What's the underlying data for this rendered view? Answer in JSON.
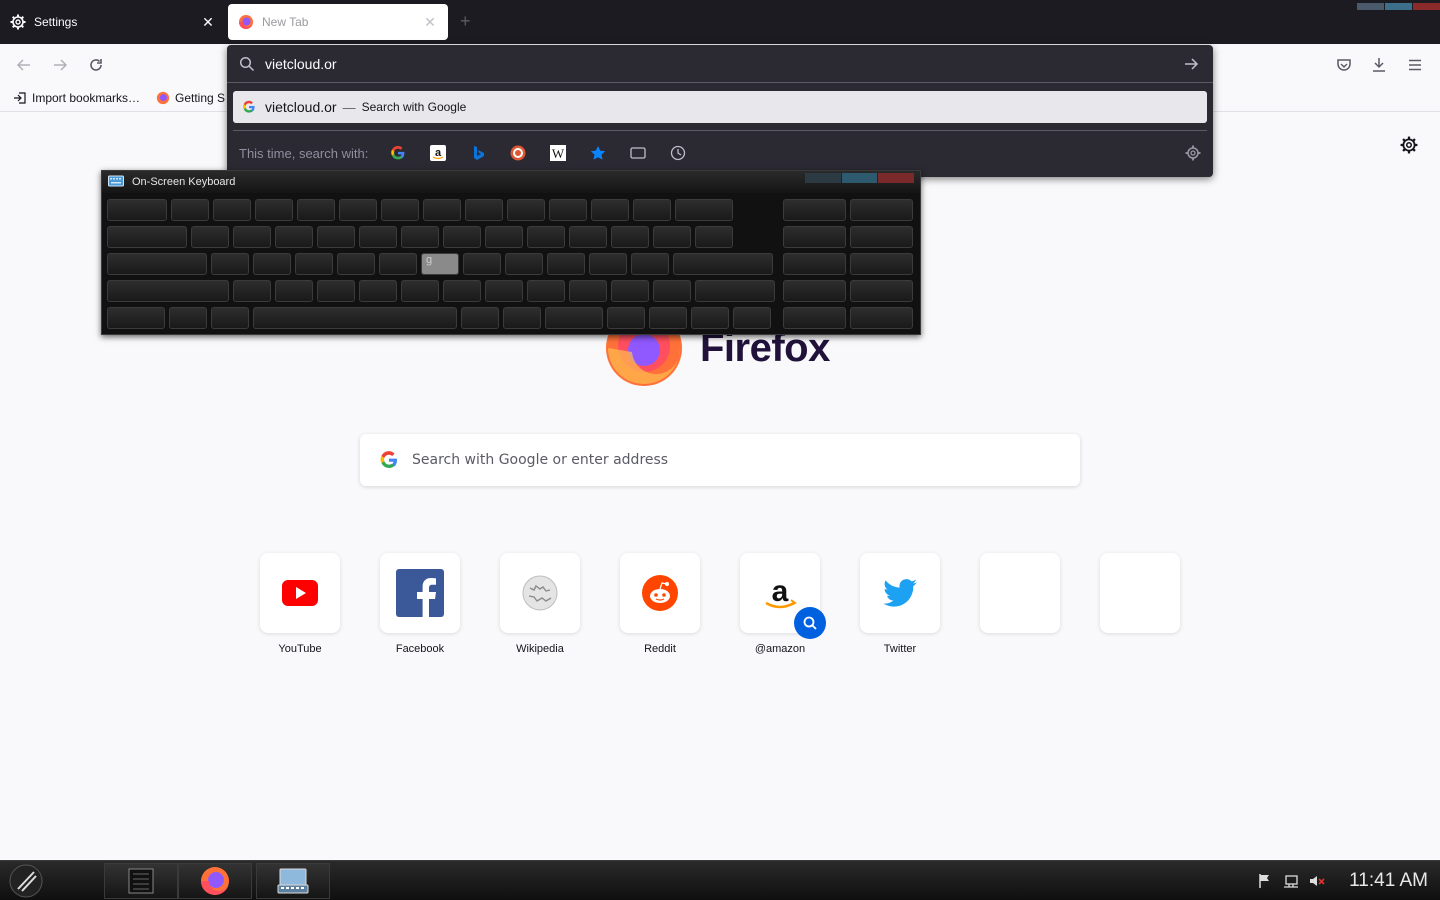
{
  "tabs": [
    {
      "label": "Settings",
      "icon": "gear-icon",
      "close": "✕"
    },
    {
      "label": "New Tab",
      "icon": "firefox-icon",
      "close": "✕"
    }
  ],
  "new_tab_symbol": "+",
  "bookmarks": [
    {
      "label": "Import bookmarks…",
      "icon": "import-icon"
    },
    {
      "label": "Getting S",
      "icon": "firefox-icon"
    }
  ],
  "urlbar": {
    "value": "vietcloud.or",
    "result": {
      "text": "vietcloud.or",
      "separator": "—",
      "action": "Search with Google"
    },
    "search_with_label": "This time, search with:",
    "engines": [
      "google-icon",
      "amazon-icon",
      "bing-icon",
      "duckduckgo-icon",
      "wikipedia-icon",
      "bookmarks-star-icon",
      "tabs-icon",
      "history-icon"
    ]
  },
  "newtab": {
    "logo_text": "Firefox",
    "search_placeholder": "Search with Google or enter address",
    "top_sites": [
      {
        "label": "YouTube",
        "icon": "youtube-icon"
      },
      {
        "label": "Facebook",
        "icon": "facebook-icon"
      },
      {
        "label": "Wikipedia",
        "icon": "wikipedia-icon"
      },
      {
        "label": "Reddit",
        "icon": "reddit-icon"
      },
      {
        "label": "@amazon",
        "icon": "amazon-icon"
      },
      {
        "label": "Twitter",
        "icon": "twitter-icon"
      },
      {
        "label": "",
        "icon": ""
      },
      {
        "label": "",
        "icon": ""
      }
    ]
  },
  "osk": {
    "title": "On-Screen Keyboard",
    "active_key": "g"
  },
  "taskbar": {
    "clock": "11:41 AM"
  },
  "colors": {
    "tabstrip": "#1c1b22",
    "urlbar_popup": "#2b2a33",
    "accent_blue": "#0061e0",
    "page_bg": "#f9f9fb"
  }
}
